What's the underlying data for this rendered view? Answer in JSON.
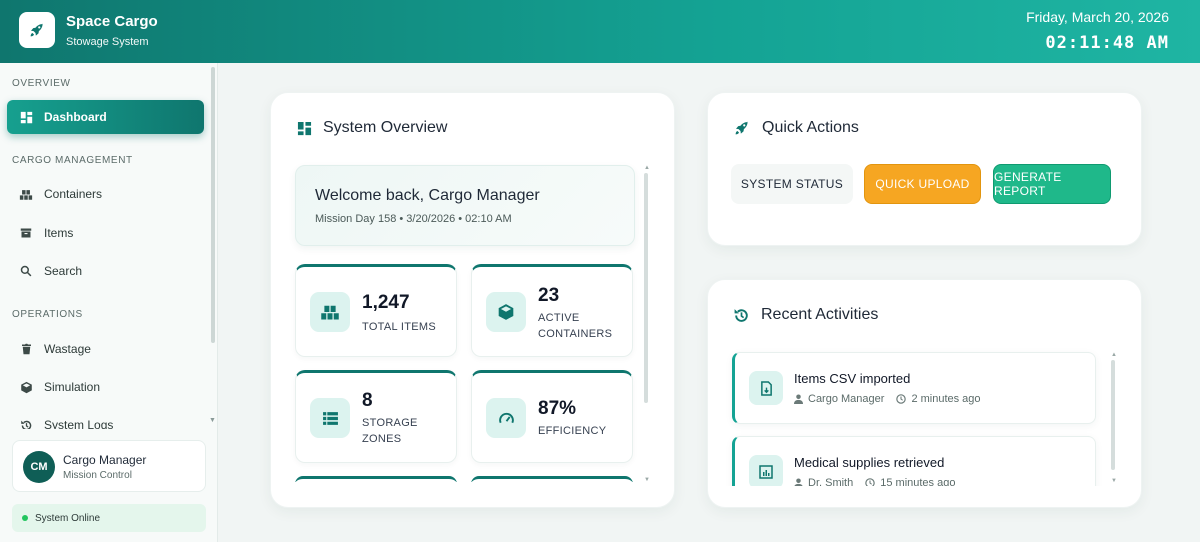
{
  "app": {
    "title": "Space Cargo",
    "subtitle": "Stowage System",
    "date": "Friday, March 20, 2026",
    "time": "02:11:48 AM"
  },
  "sidebar": {
    "sections": {
      "overview": "OVERVIEW",
      "cargo": "CARGO MANAGEMENT",
      "operations": "OPERATIONS"
    },
    "items": [
      {
        "label": "Dashboard",
        "icon": "dashboard-icon",
        "active": true
      },
      {
        "label": "Containers",
        "icon": "containers-icon"
      },
      {
        "label": "Items",
        "icon": "archive-icon"
      },
      {
        "label": "Search",
        "icon": "search-icon"
      },
      {
        "label": "Wastage",
        "icon": "trash-icon"
      },
      {
        "label": "Simulation",
        "icon": "cube-icon"
      },
      {
        "label": "System Logs",
        "icon": "history-icon"
      }
    ],
    "user": {
      "initials": "CM",
      "name": "Cargo Manager",
      "role": "Mission Control"
    },
    "status": "System Online"
  },
  "overview": {
    "title": "System Overview",
    "welcome_title": "Welcome back, Cargo Manager",
    "welcome_sub": "Mission Day 158 • 3/20/2026 • 02:10 AM",
    "stats": [
      {
        "value": "1,247",
        "label": "TOTAL ITEMS",
        "icon": "boxes-icon"
      },
      {
        "value": "23",
        "label": "ACTIVE CONTAINERS",
        "icon": "box-icon"
      },
      {
        "value": "8",
        "label": "STORAGE ZONES",
        "icon": "list-icon"
      },
      {
        "value": "87%",
        "label": "EFFICIENCY",
        "icon": "gauge-icon"
      }
    ]
  },
  "quick_actions": {
    "title": "Quick Actions",
    "status_label": "SYSTEM STATUS",
    "upload_label": "QUICK UPLOAD",
    "report_label": "GENERATE REPORT"
  },
  "activities": {
    "title": "Recent Activities",
    "items": [
      {
        "title": "Items CSV imported",
        "user": "Cargo Manager",
        "time": "2 minutes ago",
        "icon": "file-import-icon"
      },
      {
        "title": "Medical supplies retrieved",
        "user": "Dr. Smith",
        "time": "15 minutes ago",
        "icon": "chart-icon"
      }
    ]
  },
  "colors": {
    "accent": "#0f766e",
    "accent_light": "#14a394",
    "upload": "#f6a622",
    "report": "#1fb88a",
    "online": "#22c55e"
  }
}
